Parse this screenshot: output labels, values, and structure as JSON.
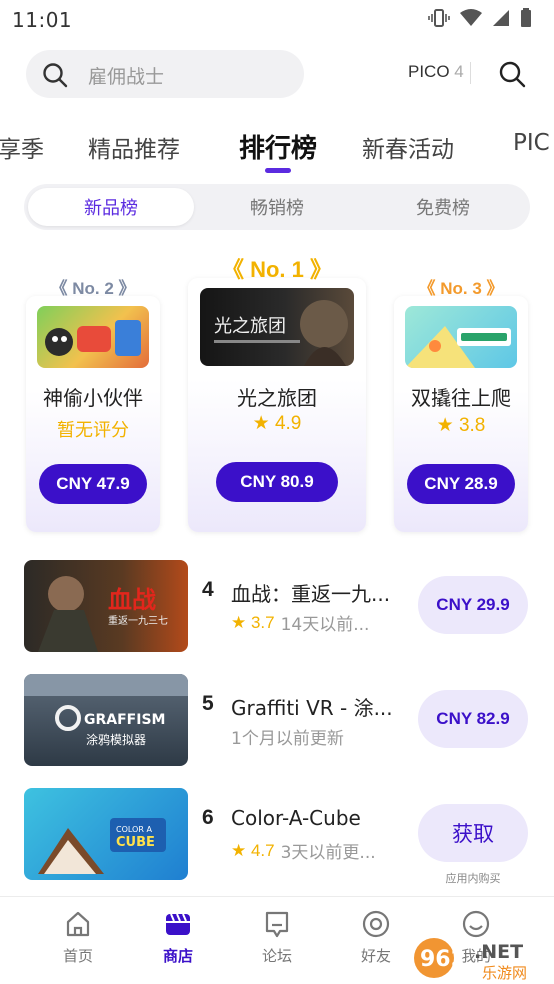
{
  "status_bar": {
    "time": "11:01"
  },
  "search": {
    "placeholder": "雇佣战士",
    "device_label": "PICO",
    "device_suffix": "4"
  },
  "tabs": [
    {
      "label": "享季"
    },
    {
      "label": "精品推荐"
    },
    {
      "label": "排行榜",
      "active": true
    },
    {
      "label": "新春活动"
    },
    {
      "label": "PIC"
    }
  ],
  "segments": [
    {
      "label": "新品榜",
      "active": true
    },
    {
      "label": "畅销榜"
    },
    {
      "label": "免费榜"
    }
  ],
  "podium": [
    {
      "rank": "No. 2",
      "thumb_text": "神偷小伙伴",
      "name": "神偷小伙伴",
      "sub": "暂无评分",
      "price": "CNY 47.9"
    },
    {
      "rank": "No. 1",
      "thumb_text": "光之旅团",
      "name": "光之旅团",
      "rating": "4.9",
      "price": "CNY 80.9"
    },
    {
      "rank": "No. 3",
      "thumb_text": "双撬往上爬",
      "name": "双撬往上爬",
      "rating": "3.8",
      "price": "CNY 28.9"
    }
  ],
  "list": [
    {
      "rank": "4",
      "title": "血战：重返一九...",
      "rating": "3.7",
      "updated": "14天以前...",
      "action": "CNY 29.9",
      "thumb_text": "血战",
      "thumb_sub": "重返一九三七"
    },
    {
      "rank": "5",
      "title": "Graffiti VR - 涂...",
      "updated": "1个月以前更新",
      "action": "CNY 82.9",
      "thumb_text": "GRAFFISM",
      "thumb_sub": "涂鸦模拟器"
    },
    {
      "rank": "6",
      "title": "Color-A-Cube",
      "rating": "4.7",
      "updated": "3天以前更...",
      "action": "获取",
      "note": "应用内购买",
      "thumb_text": "CUBE",
      "thumb_sub": "COLOR A"
    }
  ],
  "bottom_nav": [
    {
      "label": "首页",
      "icon": "home-icon"
    },
    {
      "label": "商店",
      "icon": "store-icon",
      "active": true
    },
    {
      "label": "论坛",
      "icon": "forum-icon"
    },
    {
      "label": "好友",
      "icon": "friends-icon"
    },
    {
      "label": "我的",
      "icon": "profile-icon"
    }
  ],
  "watermark": {
    "text": "962.NET",
    "sub": "乐游网"
  },
  "colors": {
    "accent": "#3b10c9",
    "accent_light": "#ece8fb",
    "gold": "#f2b200",
    "silver": "#7d8aa3",
    "bronze": "#f39a2c"
  }
}
